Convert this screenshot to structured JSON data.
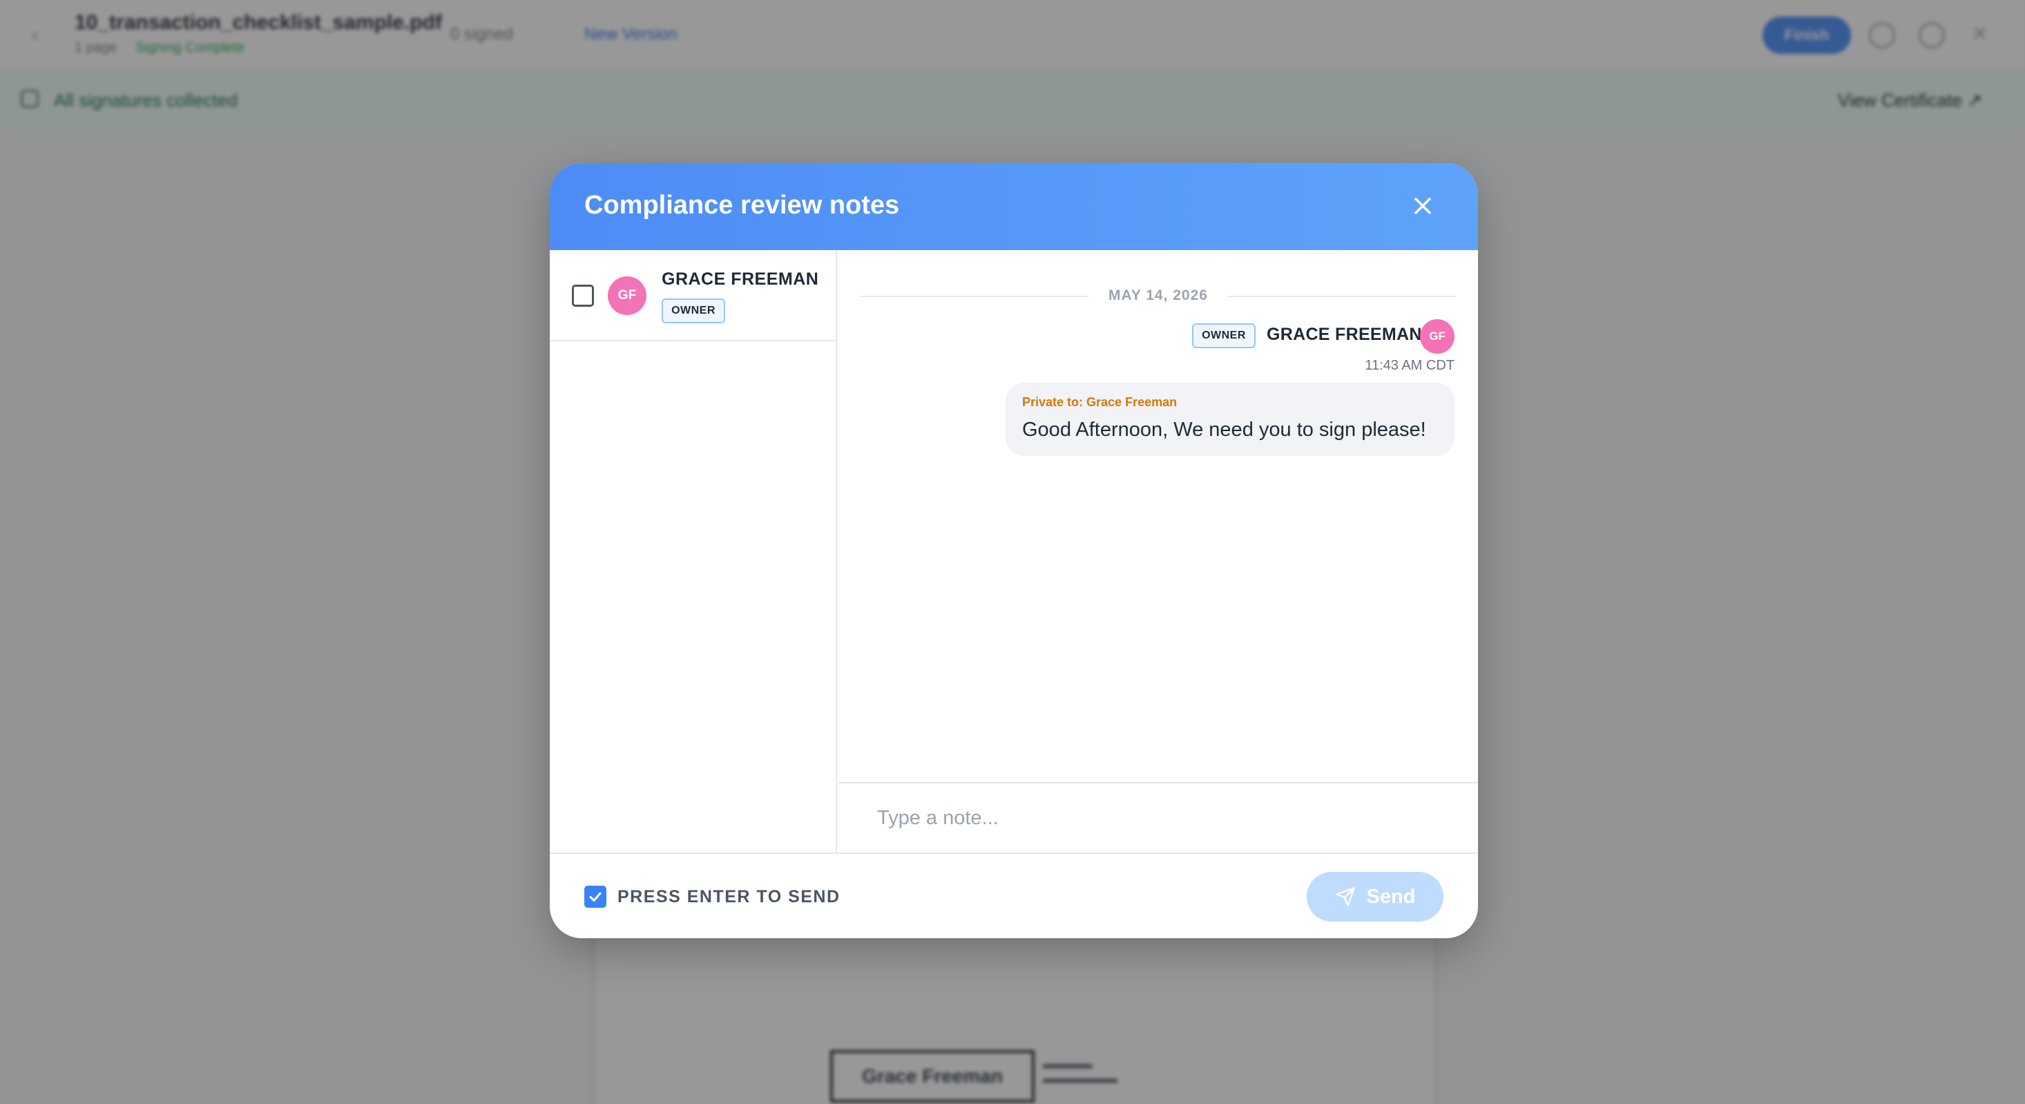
{
  "background": {
    "file_title": "10_transaction_checklist_sample.pdf",
    "file_pages": "1 page",
    "file_status": "Signing Complete",
    "signed_count": "0 signed",
    "new_version": "New Version",
    "finish_label": "Finish",
    "banner_text": "All signatures collected",
    "certificate_link": "View Certificate ↗",
    "doc_signer_name": "Grace Freeman"
  },
  "modal": {
    "title": "Compliance review notes",
    "participants": [
      {
        "initials": "GF",
        "name": "GRACE FREEMAN",
        "role": "OWNER",
        "checked": false
      }
    ],
    "date_divider": "MAY 14, 2026",
    "messages": [
      {
        "author": "GRACE FREEMAN",
        "initials": "GF",
        "role": "OWNER",
        "time": "11:43 AM CDT",
        "private_label": "Private to: Grace Freeman",
        "text": "Good Afternoon, We need you to sign please!"
      }
    ],
    "input_placeholder": "Type a note...",
    "press_enter_label": "PRESS ENTER TO SEND",
    "press_enter_checked": true,
    "send_label": "Send"
  },
  "colors": {
    "header_gradient_start": "#4d8cf5",
    "header_gradient_end": "#5ea3fb",
    "avatar": "#f472b6",
    "private_label": "#d97706",
    "send_button": "#bfdbfe"
  }
}
